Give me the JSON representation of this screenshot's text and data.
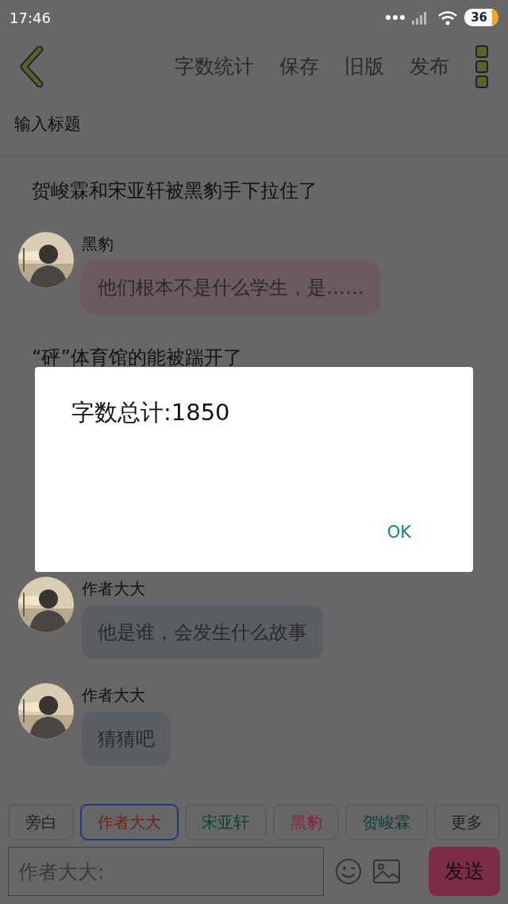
{
  "status_bar": {
    "time": "17:46",
    "battery": "36"
  },
  "toolbar": {
    "actions": [
      "字数统计",
      "保存",
      "旧版",
      "发布"
    ]
  },
  "title_field": {
    "placeholder": "输入标题"
  },
  "messages": [
    {
      "kind": "narration",
      "text": "贺峻霖和宋亚轩被黑豹手下拉住了"
    },
    {
      "kind": "chat",
      "sender": "黑豹",
      "text": "他们根本不是什么学生，是……",
      "color": "#6b5a5f"
    },
    {
      "kind": "narration",
      "text": "“砰”体育馆的能被踹开了"
    },
    {
      "kind": "chat",
      "sender": "作者大大",
      "text": "他是谁，会发生什么故事",
      "color": "#5b5f63"
    },
    {
      "kind": "chat",
      "sender": "作者大大",
      "text": "猜猜吧",
      "color": "#5b5f63"
    }
  ],
  "roles": [
    {
      "label": "旁白",
      "color": "#222222",
      "selected": false
    },
    {
      "label": "作者大大",
      "color": "#6e2418",
      "selected": true
    },
    {
      "label": "宋亚轩",
      "color": "#03462e",
      "selected": false
    },
    {
      "label": "黑豹",
      "color": "#8e1c3c",
      "selected": false
    },
    {
      "label": "贺峻霖",
      "color": "#0f3d3d",
      "selected": false
    },
    {
      "label": "更多",
      "color": "#222222",
      "selected": false
    }
  ],
  "composer": {
    "placeholder": "作者大大:",
    "send": "发送"
  },
  "dialog": {
    "message": "字数总计:1850",
    "button": "OK"
  }
}
